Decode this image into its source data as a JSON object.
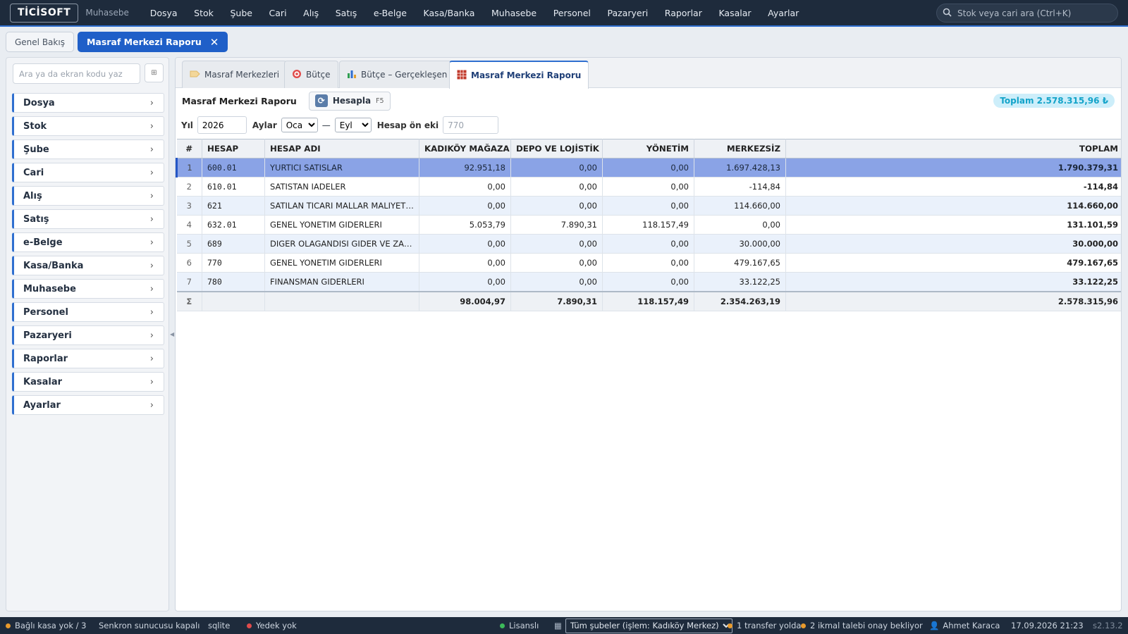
{
  "app": {
    "logo": "TİCİSOFT",
    "subtitle": "Muhasebe"
  },
  "top_menu": [
    "Dosya",
    "Stok",
    "Şube",
    "Cari",
    "Alış",
    "Satış",
    "e-Belge",
    "Kasa/Banka",
    "Muhasebe",
    "Personel",
    "Pazaryeri",
    "Raporlar",
    "Kasalar",
    "Ayarlar"
  ],
  "global_search": {
    "placeholder": "Stok veya cari ara (Ctrl+K)",
    "icon": "search-icon"
  },
  "open_tabs": [
    {
      "label": "Genel Bakış",
      "active": false
    },
    {
      "label": "Masraf Merkezi Raporu",
      "active": true,
      "close": "✕"
    }
  ],
  "sidebar": {
    "search_placeholder": "Ara ya da ekran kodu yaz",
    "grid_button": "⊞",
    "items": [
      "Dosya",
      "Stok",
      "Şube",
      "Cari",
      "Alış",
      "Satış",
      "e-Belge",
      "Kasa/Banka",
      "Muhasebe",
      "Personel",
      "Pazaryeri",
      "Raporlar",
      "Kasalar",
      "Ayarlar"
    ]
  },
  "sub_tabs": [
    {
      "label": "Masraf Merkezleri",
      "icon": "tag-icon"
    },
    {
      "label": "Bütçe",
      "icon": "target-icon"
    },
    {
      "label": "Bütçe – Gerçekleşen",
      "icon": "bar-chart-icon"
    },
    {
      "label": "Masraf Merkezi Raporu",
      "icon": "report-grid-icon",
      "active": true
    }
  ],
  "toolbar": {
    "title": "Masraf Merkezi Raporu",
    "calc_label": "Hesapla",
    "calc_key": "F5",
    "total_badge": "Toplam 2.578.315,96 ₺"
  },
  "filters": {
    "year_label": "Yıl",
    "year_value": "2026",
    "months_label": "Aylar",
    "month_from": "Oca",
    "month_sep": "—",
    "month_to": "Eyl",
    "prefix_label": "Hesap ön eki",
    "prefix_placeholder": "770"
  },
  "table": {
    "columns": [
      "#",
      "HESAP",
      "HESAP ADI",
      "KADIKÖY MAĞAZA",
      "DEPO VE LOJİSTİK",
      "YÖNETİM",
      "MERKEZSİZ",
      "TOPLAM"
    ],
    "rows": [
      [
        "1",
        "600.01",
        "YURTICI SATISLAR",
        "92.951,18",
        "0,00",
        "0,00",
        "1.697.428,13",
        "1.790.379,31"
      ],
      [
        "2",
        "610.01",
        "SATISTAN IADELER",
        "0,00",
        "0,00",
        "0,00",
        "-114,84",
        "-114,84"
      ],
      [
        "3",
        "621",
        "SATILAN TICARI MALLAR MALIYETI (-)",
        "0,00",
        "0,00",
        "0,00",
        "114.660,00",
        "114.660,00"
      ],
      [
        "4",
        "632.01",
        "GENEL YONETIM GIDERLERI",
        "5.053,79",
        "7.890,31",
        "118.157,49",
        "0,00",
        "131.101,59"
      ],
      [
        "5",
        "689",
        "DIGER OLAGANDISI GIDER VE ZARARLAR",
        "0,00",
        "0,00",
        "0,00",
        "30.000,00",
        "30.000,00"
      ],
      [
        "6",
        "770",
        "GENEL YONETIM GIDERLERI",
        "0,00",
        "0,00",
        "0,00",
        "479.167,65",
        "479.167,65"
      ],
      [
        "7",
        "780",
        "FINANSMAN GIDERLERI",
        "0,00",
        "0,00",
        "0,00",
        "33.122,25",
        "33.122,25"
      ]
    ],
    "selected_row": 1,
    "totals": [
      "Σ",
      "",
      "",
      "98.004,97",
      "7.890,31",
      "118.157,49",
      "2.354.263,19",
      "2.578.315,96"
    ]
  },
  "status_bar": {
    "cash": "Bağlı kasa yok / 3",
    "sync": "Senkron sunucusu kapalı",
    "db": "sqlite",
    "backup": "Yedek yok",
    "license": "Lisanslı",
    "branch": "Tüm şubeler (işlem: Kadıköy Merkez)",
    "transfer": "1 transfer yolda",
    "requests": "2 ikmal talebi onay bekliyor",
    "user": "Ahmet Karaca",
    "datetime": "17.09.2026 21:23",
    "version": "s2.13.2"
  },
  "colors": {
    "accent": "#2f6fd0",
    "topbar": "#1e2b3c",
    "selected_row": "#8aa3e6",
    "badge_text": "#12a3c9"
  }
}
